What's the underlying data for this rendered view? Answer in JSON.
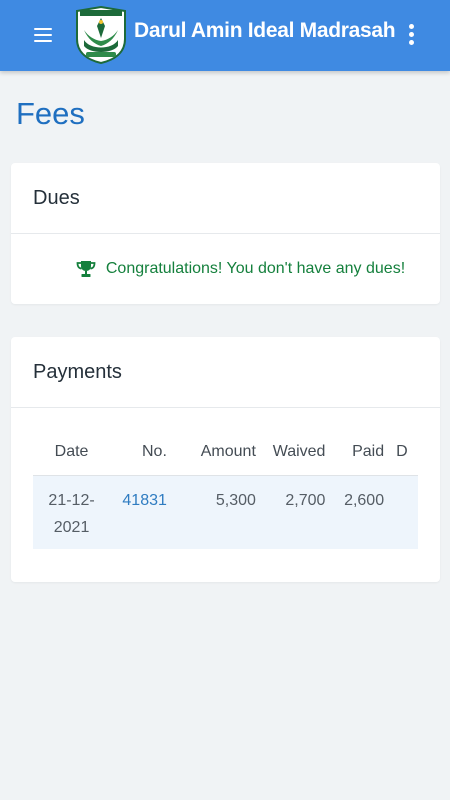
{
  "appbar": {
    "title": "Darul Amin Ideal Madrasah",
    "menu_icon": "hamburger-menu-icon",
    "more_icon": "more-vertical-icon",
    "background_color": "#3f8ae2"
  },
  "page": {
    "title": "Fees"
  },
  "dues": {
    "header": "Dues",
    "icon": "trophy-icon",
    "message": "Congratulations! You don't have any dues!",
    "message_color": "#15803d"
  },
  "payments": {
    "header": "Payments",
    "columns": [
      "Date",
      "No.",
      "Amount",
      "Waived",
      "Paid",
      "D"
    ],
    "rows": [
      {
        "date_line1": "21-12-",
        "date_line2": "2021",
        "no": "41831",
        "amount": "5,300",
        "waived": "2,700",
        "paid": "2,600",
        "due": ""
      }
    ]
  }
}
